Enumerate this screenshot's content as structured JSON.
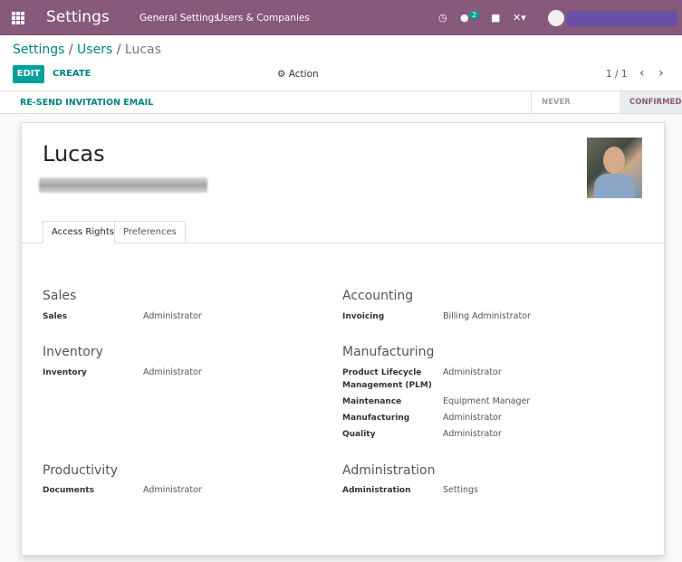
{
  "navbar": {
    "app_title": "Settings",
    "menu": [
      "General Settings",
      "Users & Companies"
    ],
    "chat_count": "2",
    "icons": [
      "apps-icon",
      "clock-icon",
      "chat-icon",
      "gift-icon",
      "tools-icon",
      "avatar"
    ]
  },
  "breadcrumb": [
    "Settings",
    "Users",
    "Lucas"
  ],
  "breadcrumb_sep": "/",
  "toolbar": {
    "edit_label": "EDIT",
    "create_label": "CREATE",
    "action_label": "Action",
    "pager": "1 / 1"
  },
  "statusbar": {
    "resend_label": "RE-SEND INVITATION EMAIL",
    "stages": [
      "NEVER CONNECTED",
      "CONFIRMED"
    ],
    "active_stage": "CONFIRMED"
  },
  "user": {
    "name": "Lucas"
  },
  "tabs": [
    "Access Rights",
    "Preferences"
  ],
  "groups": {
    "sales": {
      "title": "Sales",
      "fields": [
        {
          "label": "Sales",
          "value": "Administrator"
        }
      ]
    },
    "inventory": {
      "title": "Inventory",
      "fields": [
        {
          "label": "Inventory",
          "value": "Administrator"
        }
      ]
    },
    "productivity": {
      "title": "Productivity",
      "fields": [
        {
          "label": "Documents",
          "value": "Administrator"
        }
      ]
    },
    "accounting": {
      "title": "Accounting",
      "fields": [
        {
          "label": "Invoicing",
          "value": "Billing Administrator"
        }
      ]
    },
    "manufacturing": {
      "title": "Manufacturing",
      "fields": [
        {
          "label": "Product Lifecycle Management (PLM)",
          "value": "Administrator"
        },
        {
          "label": "Maintenance",
          "value": "Equipment Manager"
        },
        {
          "label": "Manufacturing",
          "value": "Administrator"
        },
        {
          "label": "Quality",
          "value": "Administrator"
        }
      ]
    },
    "administration": {
      "title": "Administration",
      "fields": [
        {
          "label": "Administration",
          "value": "Settings"
        }
      ]
    }
  },
  "colors": {
    "brand": "#875a7b",
    "accent": "#00a09d",
    "link": "#00837f"
  }
}
